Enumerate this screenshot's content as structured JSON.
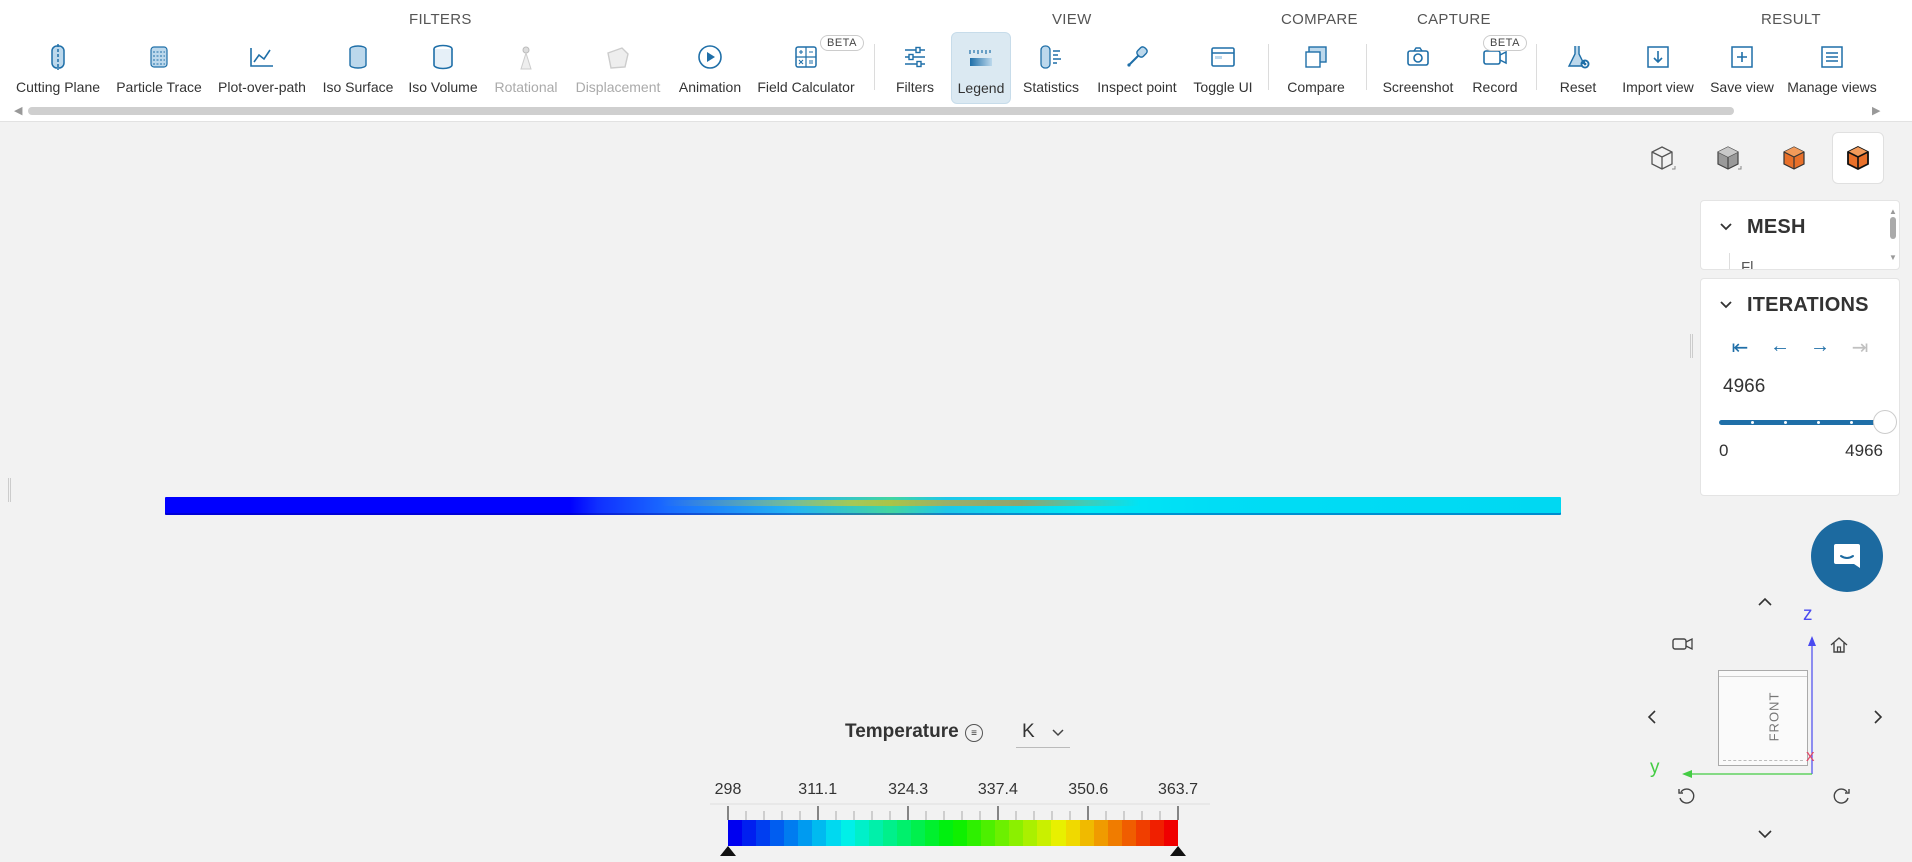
{
  "toolbar": {
    "groups": {
      "filters": "FILTERS",
      "view": "VIEW",
      "compare": "COMPARE",
      "capture": "CAPTURE",
      "result": "RESULT"
    },
    "buttons": {
      "cutting_plane": "Cutting Plane",
      "particle_trace": "Particle Trace",
      "plot_over_path": "Plot-over-path",
      "iso_surface": "Iso Surface",
      "iso_volume": "Iso Volume",
      "rotational": "Rotational",
      "displacement": "Displacement",
      "animation": "Animation",
      "field_calculator": "Field Calculator",
      "filters": "Filters",
      "legend": "Legend",
      "statistics": "Statistics",
      "inspect_point": "Inspect point",
      "toggle_ui": "Toggle UI",
      "compare": "Compare",
      "screenshot": "Screenshot",
      "record": "Record",
      "reset": "Reset",
      "import_view": "Import view",
      "save_view": "Save view",
      "manage_views": "Manage views"
    },
    "beta_badge": "BETA"
  },
  "panels": {
    "mesh": {
      "title": "MESH",
      "partial_item": "Fl..."
    },
    "iterations": {
      "title": "ITERATIONS",
      "current": "4966",
      "min": "0",
      "max": "4966",
      "slider_fraction": 1.0
    }
  },
  "gizmo": {
    "face_label": "FRONT",
    "axis_z": "z",
    "axis_y": "y",
    "axis_x": "x"
  },
  "legend": {
    "title": "Temperature",
    "unit": "K",
    "ticks": [
      "298",
      "311.1",
      "324.3",
      "337.4",
      "350.6",
      "363.7"
    ],
    "min": 298,
    "max": 363.7
  },
  "colors": {
    "accent": "#1f6fa8",
    "active_bg": "#dbe9f2",
    "chat": "#1c6aa0",
    "axis_x": "#e24a6a",
    "axis_y": "#44cc44",
    "axis_z": "#4a4af0"
  }
}
